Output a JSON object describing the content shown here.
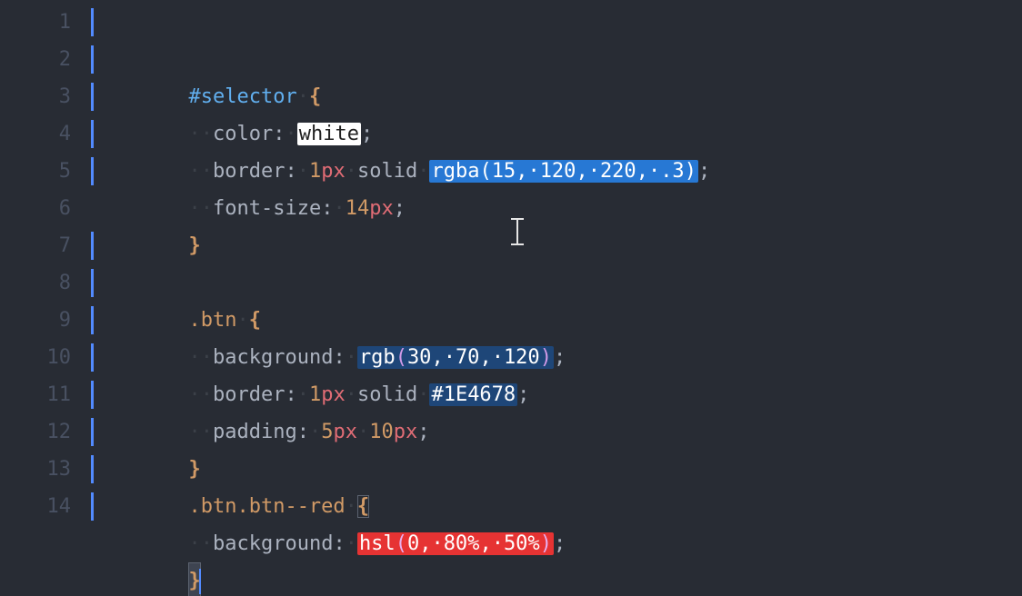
{
  "editor": {
    "lineNumbers": [
      "1",
      "2",
      "3",
      "4",
      "5",
      "6",
      "7",
      "8",
      "9",
      "10",
      "11",
      "12",
      "13",
      "14"
    ],
    "invisibles": {
      "space": "·"
    },
    "lines": {
      "l1": {
        "selector": "#selector",
        "brace": "{"
      },
      "l2": {
        "prop": "color",
        "value_named": "white"
      },
      "l3": {
        "prop": "border",
        "len_num": "1",
        "len_unit": "px",
        "style": "solid",
        "fn": "rgba",
        "a1": "15",
        "a2": "120",
        "a3": "220",
        "a4": ".3"
      },
      "l4": {
        "prop": "font-size",
        "num": "14",
        "unit": "px"
      },
      "l5": {
        "brace": "}"
      },
      "l7": {
        "selector": ".btn",
        "brace": "{"
      },
      "l8": {
        "prop": "background",
        "fn": "rgb",
        "a1": "30",
        "a2": "70",
        "a3": "120"
      },
      "l9": {
        "prop": "border",
        "len_num": "1",
        "len_unit": "px",
        "style": "solid",
        "hex": "#1E4678"
      },
      "l10": {
        "prop": "padding",
        "n1": "5",
        "u1": "px",
        "n2": "10",
        "u2": "px"
      },
      "l11": {
        "brace": "}"
      },
      "l12": {
        "selector": ".btn.btn--red",
        "brace": "{"
      },
      "l13": {
        "prop": "background",
        "fn": "hsl",
        "a1": "0",
        "a2": "80%",
        "a3": "50%"
      },
      "l14": {
        "brace": "}"
      }
    },
    "color_swatches": {
      "white": "#ffffff",
      "rgba_15_120_220_03": "rgba(15,120,220,.3)",
      "rgb_30_70_120": "#1e4678",
      "hex_1E4678": "#1E4678",
      "hsl_0_80_50": "#e63333"
    }
  }
}
